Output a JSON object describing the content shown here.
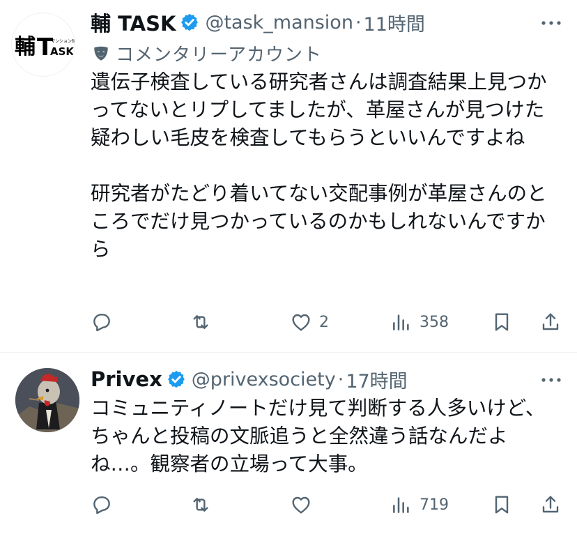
{
  "posts": [
    {
      "name": "輔 TASK",
      "handle": "@task_mansion",
      "separator": "·",
      "time": "11時間",
      "label": "コメンタリーアカウント",
      "avatar_text": "輔TASK",
      "avatar_small": "マンション研究",
      "text": "遺伝子検査している研究者さんは調査結果上見つかってないとリプしてましたが、革屋さんが見つけた疑わしい毛皮を検査してもらうといいんですよね\n\n研究者がたどり着いてない交配事例が革屋さんのところでだけ見つかっているのかもしれないんですから",
      "replies": "",
      "reposts": "",
      "likes": "2",
      "views": "358"
    },
    {
      "name": "Privex",
      "handle": "@privexsociety",
      "separator": "·",
      "time": "17時間",
      "text": "コミュニティノートだけ見て判断する人多いけど、ちゃんと投稿の文脈追うと全然違う話なんだよね…。観察者の立場って大事。",
      "replies": "",
      "reposts": "",
      "likes": "",
      "views": "719"
    }
  ],
  "icons": [
    "verified-badge-icon",
    "more-icon",
    "mask-icon",
    "reply-icon",
    "repost-icon",
    "like-icon",
    "views-icon",
    "bookmark-icon",
    "share-icon"
  ],
  "colors": {
    "verified": "#1d9bf0",
    "secondary": "#536471",
    "text": "#0f1419"
  }
}
